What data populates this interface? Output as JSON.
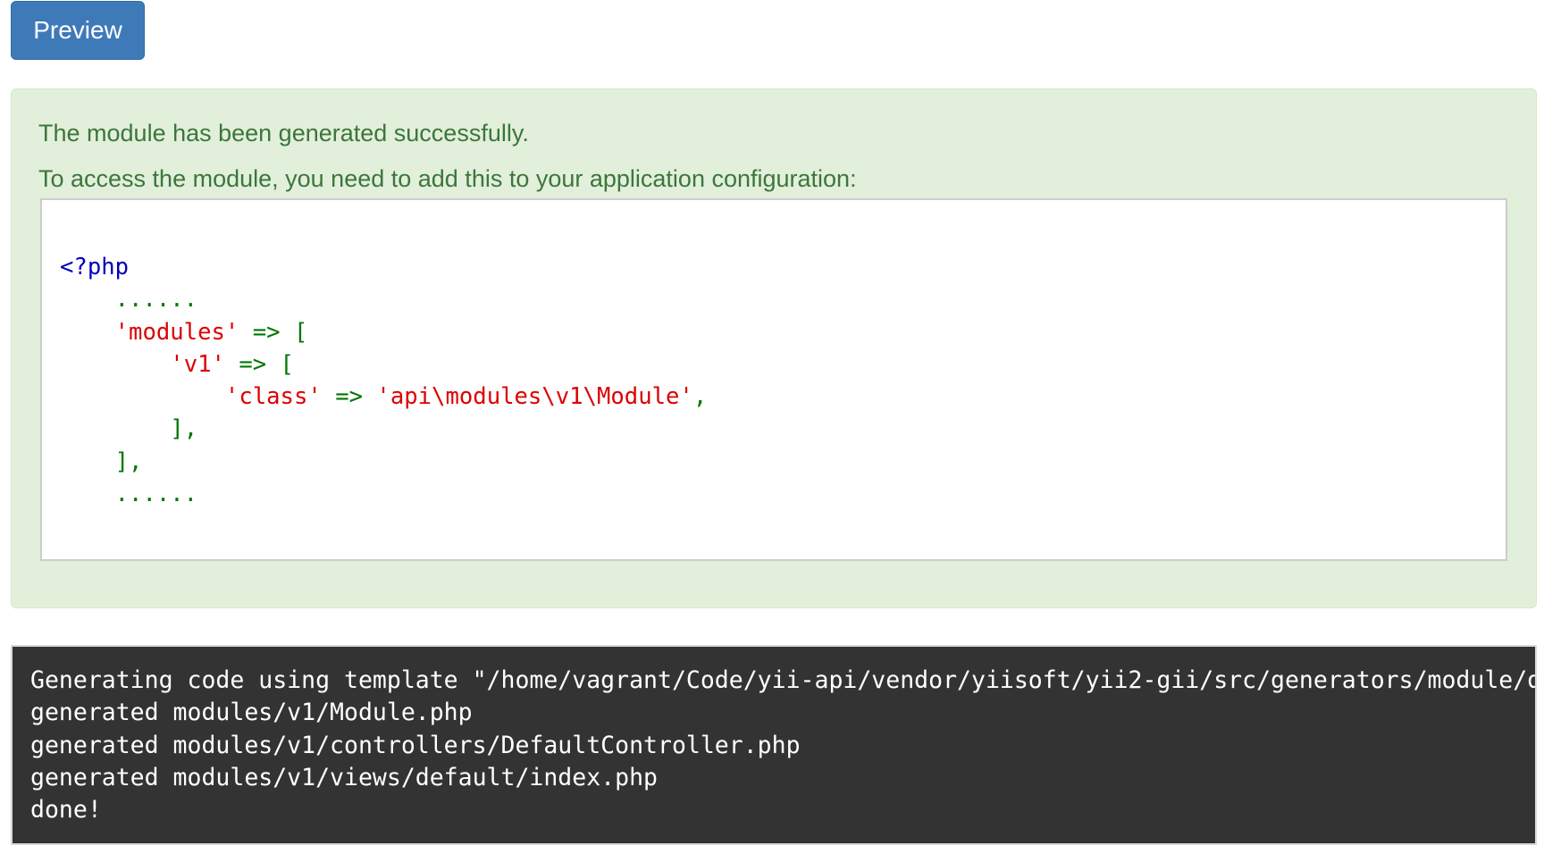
{
  "toolbar": {
    "preview_label": "Preview"
  },
  "alert": {
    "success_message": "The module has been generated successfully.",
    "config_instruction": "To access the module, you need to add this to your application configuration:",
    "code": {
      "php_open": "<?php",
      "ellipsis_top": "......",
      "modules_key": "'modules'",
      "modules_arrow": " => [",
      "v1_key": "'v1'",
      "v1_arrow": " => [",
      "class_key": "'class'",
      "class_arrow": " => ",
      "class_value": "'api\\modules\\v1\\Module'",
      "class_comma": ",",
      "close_inner": "],",
      "close_outer": "],",
      "ellipsis_bottom": "......"
    }
  },
  "console": {
    "lines": [
      "Generating code using template \"/home/vagrant/Code/yii-api/vendor/yiisoft/yii2-gii/src/generators/module/default\"...",
      "generated modules/v1/Module.php",
      "generated modules/v1/controllers/DefaultController.php",
      "generated modules/v1/views/default/index.php",
      "done!"
    ]
  },
  "colors": {
    "button_bg": "#3f7ab8",
    "alert_bg": "#e2efda",
    "alert_text": "#3c763d",
    "php_tag": "#0000bb",
    "php_string": "#dd0000",
    "php_punctuation": "#007700",
    "console_bg": "#333333"
  }
}
